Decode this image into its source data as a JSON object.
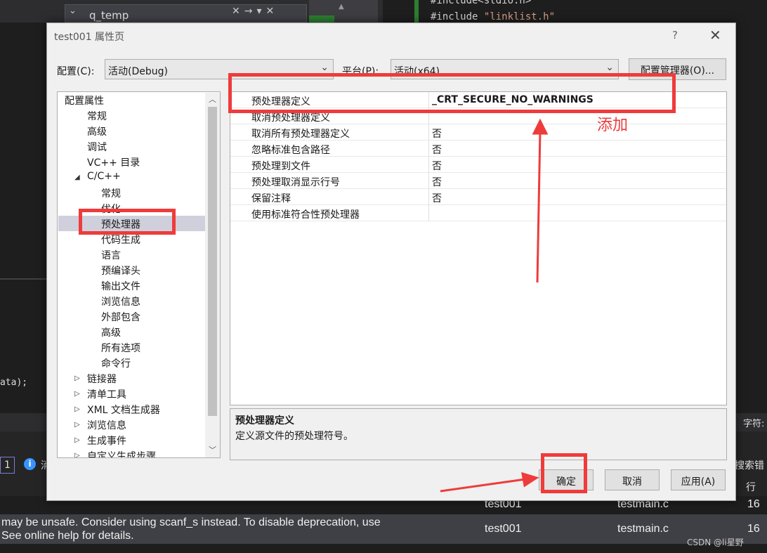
{
  "background": {
    "tab_title": "q_temp",
    "code_line1": "#include<stdio.h>",
    "code_line2_prefix": "#include ",
    "code_line2_string": "\"linklist.h\"",
    "partial_code": "ata);",
    "right_header": "字符:",
    "error_count": "1",
    "error_partial": "消",
    "search_partial": "搜索错",
    "line_col_header": "行",
    "rows": [
      {
        "desc": "",
        "project": "test001",
        "file": "testmain.c",
        "line": "16"
      },
      {
        "desc": "may be unsafe. Consider using scanf_s instead. To disable deprecation, use",
        "desc2": "See online help for details.",
        "project": "test001",
        "file": "testmain.c",
        "line": "16"
      }
    ],
    "watermark": "CSDN @li星野"
  },
  "dialog": {
    "title": "test001 属性页",
    "help": "?",
    "close": "✕",
    "config_label": "配置(C):",
    "config_value": "活动(Debug)",
    "platform_label": "平台(P):",
    "platform_value": "活动(x64)",
    "config_manager": "配置管理器(O)...",
    "tree": [
      {
        "label": "配置属性",
        "level": 0,
        "toggle": "◢"
      },
      {
        "label": "常规",
        "level": 1
      },
      {
        "label": "高级",
        "level": 1
      },
      {
        "label": "调试",
        "level": 1
      },
      {
        "label": "VC++ 目录",
        "level": 1
      },
      {
        "label": "C/C++",
        "level": 1,
        "toggle": "◢"
      },
      {
        "label": "常规",
        "level": 2
      },
      {
        "label": "优化",
        "level": 2
      },
      {
        "label": "预处理器",
        "level": 2,
        "selected": true
      },
      {
        "label": "代码生成",
        "level": 2
      },
      {
        "label": "语言",
        "level": 2
      },
      {
        "label": "预编译头",
        "level": 2
      },
      {
        "label": "输出文件",
        "level": 2
      },
      {
        "label": "浏览信息",
        "level": 2
      },
      {
        "label": "外部包含",
        "level": 2
      },
      {
        "label": "高级",
        "level": 2
      },
      {
        "label": "所有选项",
        "level": 2
      },
      {
        "label": "命令行",
        "level": 2
      },
      {
        "label": "链接器",
        "level": 1,
        "toggle": "▷"
      },
      {
        "label": "清单工具",
        "level": 1,
        "toggle": "▷"
      },
      {
        "label": "XML 文档生成器",
        "level": 1,
        "toggle": "▷"
      },
      {
        "label": "浏览信息",
        "level": 1,
        "toggle": "▷"
      },
      {
        "label": "生成事件",
        "level": 1,
        "toggle": "▷"
      },
      {
        "label": "自定义生成步骤",
        "level": 1,
        "toggle": "▷"
      }
    ],
    "properties": [
      {
        "name": "预处理器定义",
        "value": "_CRT_SECURE_NO_WARNINGS"
      },
      {
        "name": "取消预处理器定义",
        "value": ""
      },
      {
        "name": "取消所有预处理器定义",
        "value": "否"
      },
      {
        "name": "忽略标准包含路径",
        "value": "否"
      },
      {
        "name": "预处理到文件",
        "value": "否"
      },
      {
        "name": "预处理取消显示行号",
        "value": "否"
      },
      {
        "name": "保留注释",
        "value": "否"
      },
      {
        "name": "使用标准符合性预处理器",
        "value": ""
      }
    ],
    "desc_title": "预处理器定义",
    "desc_text": "定义源文件的预处理符号。",
    "ok": "确定",
    "cancel": "取消",
    "apply": "应用(A)"
  },
  "annotation": {
    "label": "添加",
    "color": "#ef3b3b"
  }
}
